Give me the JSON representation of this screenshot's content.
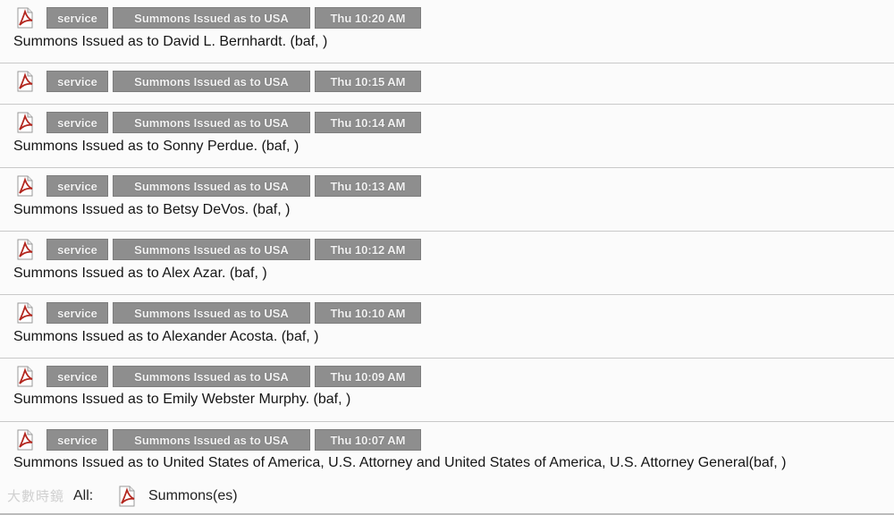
{
  "entries": [
    {
      "tag_service": "service",
      "tag_type": "Summons Issued as to USA",
      "tag_time": "Thu 10:20 AM",
      "description": "Summons Issued as to David L. Bernhardt. (baf, )"
    },
    {
      "tag_service": "service",
      "tag_type": "Summons Issued as to USA",
      "tag_time": "Thu 10:15 AM",
      "description": ""
    },
    {
      "tag_service": "service",
      "tag_type": "Summons Issued as to USA",
      "tag_time": "Thu 10:14 AM",
      "description": "Summons Issued as to Sonny Perdue. (baf, )"
    },
    {
      "tag_service": "service",
      "tag_type": "Summons Issued as to USA",
      "tag_time": "Thu 10:13 AM",
      "description": "Summons Issued as to Betsy DeVos. (baf, )"
    },
    {
      "tag_service": "service",
      "tag_type": "Summons Issued as to USA",
      "tag_time": "Thu 10:12 AM",
      "description": "Summons Issued as to Alex Azar. (baf, )"
    },
    {
      "tag_service": "service",
      "tag_type": "Summons Issued as to USA",
      "tag_time": "Thu 10:10 AM",
      "description": "Summons Issued as to Alexander Acosta. (baf, )"
    },
    {
      "tag_service": "service",
      "tag_type": "Summons Issued as to USA",
      "tag_time": "Thu 10:09 AM",
      "description": "Summons Issued as to Emily Webster Murphy. (baf, )"
    },
    {
      "tag_service": "service",
      "tag_type": "Summons Issued as to USA",
      "tag_time": "Thu 10:07 AM",
      "description": "Summons Issued as to United States of America, U.S. Attorney and United States of America, U.S. Attorney General(baf, )"
    }
  ],
  "footer": {
    "watermark": "大數時鏡",
    "all_label": "All:",
    "attachment_label": "Summons(es)"
  },
  "icons": {
    "document": "pdf-icon"
  },
  "colors": {
    "tag_bg": "#8e8e8e",
    "pdf_red": "#b3261e"
  }
}
